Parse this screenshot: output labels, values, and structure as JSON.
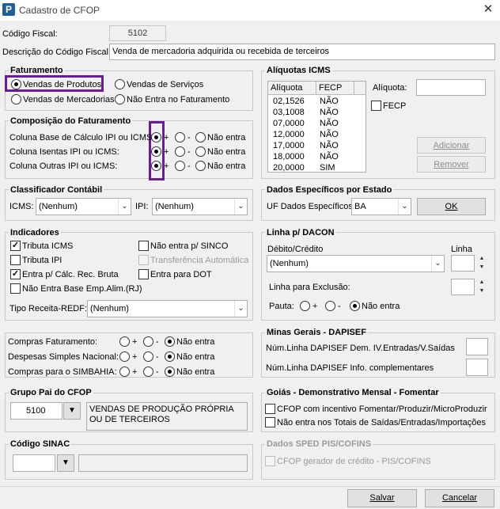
{
  "window": {
    "title": "Cadastro de CFOP",
    "app_icon": "P"
  },
  "header": {
    "codigo_label": "Código Fiscal:",
    "codigo_value": "5102",
    "descricao_label": "Descrição do Código Fiscal:",
    "descricao_value": "Venda de mercadoria adquirida ou recebida de terceiros"
  },
  "faturamento": {
    "title": "Faturamento",
    "options": [
      "Vendas de Produtos",
      "Vendas de Serviços",
      "Vendas de Mercadorias",
      "Não Entra no Faturamento"
    ],
    "selected": "Vendas de Produtos"
  },
  "composicao": {
    "title": "Composição do Faturamento",
    "plus": "+",
    "minus": "-",
    "nao": "Não entra",
    "rows": [
      "Coluna Base de Cálculo IPI ou ICMS:",
      "Coluna Isentas IPI ou ICMS:",
      "Coluna Outras IPI ou ICMS:"
    ]
  },
  "aliquotas": {
    "title": "Alíquotas ICMS",
    "col1": "Alíquota",
    "col2": "FECP",
    "rows": [
      {
        "a": "02,1526",
        "f": "NÃO"
      },
      {
        "a": "03,1008",
        "f": "NÃO"
      },
      {
        "a": "07,0000",
        "f": "NÃO"
      },
      {
        "a": "12,0000",
        "f": "NÃO"
      },
      {
        "a": "17,0000",
        "f": "NÃO"
      },
      {
        "a": "18,0000",
        "f": "NÃO"
      },
      {
        "a": "20,0000",
        "f": "SIM"
      }
    ],
    "aliquota_label": "Alíquota:",
    "fecp_label": "FECP",
    "adicionar": "Adicionar",
    "remover": "Remover"
  },
  "classificador": {
    "title": "Classificador Contábil",
    "icms_label": "ICMS:",
    "icms_value": "(Nenhum)",
    "ipi_label": "IPI:",
    "ipi_value": "(Nenhum)"
  },
  "especificos": {
    "title": "Dados Específicos por Estado",
    "uf_label": "UF Dados Específicos:",
    "uf_value": "BA",
    "ok": "OK"
  },
  "indicadores": {
    "title": "Indicadores",
    "tributa_icms": "Tributa ICMS",
    "tributa_ipi": "Tributa IPI",
    "entra_calc": "Entra p/ Cálc. Rec. Bruta",
    "nao_entra_base": "Não Entra Base Emp.Alim.(RJ)",
    "nao_entra_sinco": "Não entra p/ SINCO",
    "transferencia": "Transferência Automática",
    "entra_dot": "Entra para DOT",
    "tipo_receita_label": "Tipo Receita-REDF:",
    "tipo_receita_value": "(Nenhum)"
  },
  "dacon": {
    "title": "Linha p/ DACON",
    "debito_label": "Débito/Crédito",
    "debito_value": "(Nenhum)",
    "linha_label": "Linha",
    "exclusao_label": "Linha para Exclusão:",
    "pauta_label": "Pauta:",
    "plus": "+",
    "minus": "-",
    "nao": "Não entra"
  },
  "compras": {
    "plus": "+",
    "minus": "-",
    "nao": "Não entra",
    "rows": [
      "Compras Faturamento:",
      "Despesas Simples Nacional:",
      "Compras para o SIMBAHIA:"
    ]
  },
  "minas": {
    "title": "Minas Gerais - DAPISEF",
    "linha1": "Núm.Linha DAPISEF Dem. IV.Entradas/V.Saídas",
    "linha2": "Núm.Linha DAPISEF Info. complementares"
  },
  "grupo": {
    "title": "Grupo Pai do CFOP",
    "code": "5100",
    "desc": "VENDAS DE PRODUÇÃO PRÓPRIA OU DE TERCEIROS"
  },
  "goias": {
    "title": "Goiás - Demonstrativo Mensal - Fomentar",
    "opt1": "CFOP com incentivo  Fomentar/Produzir/MicroProduzir",
    "opt2": "Não entra nos Totais de  Saídas/Entradas/Importações"
  },
  "sinac": {
    "title": "Código SINAC"
  },
  "sped": {
    "title": "Dados SPED PIS/COFINS",
    "opt": "CFOP gerador de crédito - PIS/COFINS"
  },
  "footer": {
    "salvar": "Salvar",
    "cancelar": "Cancelar"
  },
  "colors": {
    "highlight": "#6a1b9a",
    "app_icon": "#1f5f99"
  }
}
